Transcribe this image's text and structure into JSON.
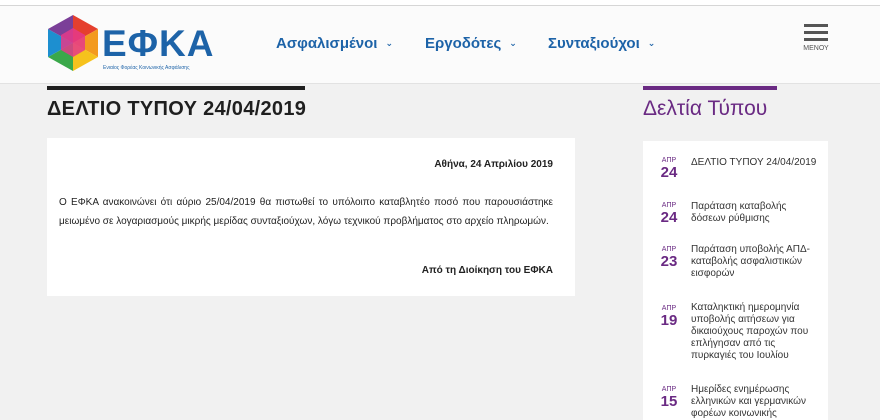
{
  "logo": {
    "word": "ΕΦΚΑ",
    "tagline": "Ενιαίος Φορέας Κοινωνικής Ασφάλισης"
  },
  "nav": {
    "items": [
      {
        "label": "Ασφαλισμένοι"
      },
      {
        "label": "Εργοδότες"
      },
      {
        "label": "Συνταξιούχοι"
      }
    ],
    "menu_label": "ΜΕΝΟΥ"
  },
  "article": {
    "title": "ΔΕΛΤΙΟ ΤΥΠΟΥ 24/04/2019",
    "date_line": "Αθήνα, 24 Απριλίου 2019",
    "body": "Ο ΕΦΚΑ ανακοινώνει ότι αύριο 25/04/2019 θα πιστωθεί το υπόλοιπο καταβλητέο ποσό που παρουσιάστηκε μειωμένο σε λογαριασμούς μικρής μερίδας συνταξιούχων, λόγω τεχνικού προβλήματος στο αρχείο πληρωμών.",
    "signature": "Από τη Διοίκηση του ΕΦΚΑ"
  },
  "sidebar": {
    "title": "Δελτία Τύπου",
    "items": [
      {
        "month": "ΑΠΡ",
        "day": "24",
        "text": "ΔΕΛΤΙΟ ΤΥΠΟΥ 24/04/2019"
      },
      {
        "month": "ΑΠΡ",
        "day": "24",
        "text": "Παράταση καταβολής δόσεων ρύθμισης"
      },
      {
        "month": "ΑΠΡ",
        "day": "23",
        "text": "Παράταση υποβολής ΑΠΔ-καταβολής ασφαλιστικών εισφορών"
      },
      {
        "month": "ΑΠΡ",
        "day": "19",
        "text": "Καταληκτική ημερομηνία υποβολής αιτήσεων για δικαιούχους παροχών που επλήγησαν από τις πυρκαγιές του Ιουλίου"
      },
      {
        "month": "ΑΠΡ",
        "day": "15",
        "text": "Ημερίδες ενημέρωσης ελληνικών και γερμανικών φορέων κοινωνικής"
      }
    ]
  },
  "colors": {
    "brand_blue": "#1d63a8",
    "accent_purple": "#6a2a83"
  }
}
